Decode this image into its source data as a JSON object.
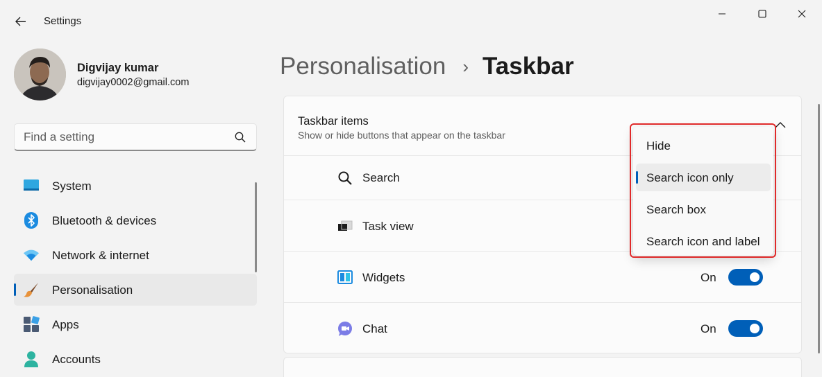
{
  "window": {
    "title": "Settings",
    "controls": [
      "minimize",
      "maximize",
      "close"
    ]
  },
  "profile": {
    "name": "Digvijay kumar",
    "email": "digvijay0002@gmail.com"
  },
  "search": {
    "placeholder": "Find a setting"
  },
  "sidebar": {
    "items": [
      {
        "label": "System",
        "icon": "system-icon",
        "selected": false
      },
      {
        "label": "Bluetooth & devices",
        "icon": "bluetooth-icon",
        "selected": false
      },
      {
        "label": "Network & internet",
        "icon": "wifi-icon",
        "selected": false
      },
      {
        "label": "Personalisation",
        "icon": "brush-icon",
        "selected": true
      },
      {
        "label": "Apps",
        "icon": "apps-icon",
        "selected": false
      },
      {
        "label": "Accounts",
        "icon": "accounts-icon",
        "selected": false
      }
    ]
  },
  "header": {
    "parent": "Personalisation",
    "separator": "›",
    "current": "Taskbar"
  },
  "taskbar_items": {
    "title": "Taskbar items",
    "subtitle": "Show or hide buttons that appear on the taskbar",
    "rows": [
      {
        "label": "Search",
        "icon": "search-icon"
      },
      {
        "label": "Task view",
        "icon": "task-view-icon"
      },
      {
        "label": "Widgets",
        "icon": "widgets-icon",
        "state": "On"
      },
      {
        "label": "Chat",
        "icon": "chat-icon",
        "state": "On"
      }
    ]
  },
  "search_dropdown": {
    "options": [
      "Hide",
      "Search icon only",
      "Search box",
      "Search icon and label"
    ],
    "selected": "Search icon only"
  },
  "colors": {
    "accent": "#005fb8",
    "highlight": "#e02a2a"
  }
}
